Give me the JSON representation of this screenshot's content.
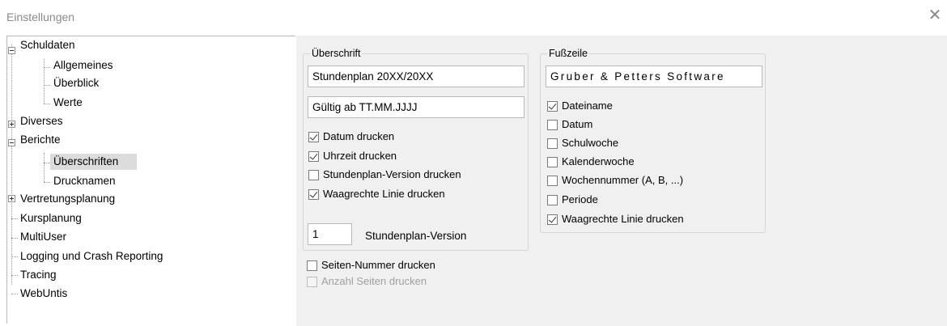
{
  "window": {
    "title": "Einstellungen",
    "close_glyph": "✕"
  },
  "tree": {
    "items": [
      {
        "label": "Schuldaten",
        "level": 0,
        "expander": "minus"
      },
      {
        "label": "Allgemeines",
        "level": 1
      },
      {
        "label": "Überblick",
        "level": 1
      },
      {
        "label": "Werte",
        "level": 1
      },
      {
        "label": "Diverses",
        "level": 0,
        "expander": "plus"
      },
      {
        "label": "Berichte",
        "level": 0,
        "expander": "minus"
      },
      {
        "label": "Überschriften",
        "level": 1,
        "selected": true
      },
      {
        "label": "Drucknamen",
        "level": 1
      },
      {
        "label": "Vertretungsplanung",
        "level": 0,
        "expander": "plus"
      },
      {
        "label": "Kursplanung",
        "level": 0
      },
      {
        "label": "MultiUser",
        "level": 0
      },
      {
        "label": "Logging und Crash Reporting",
        "level": 0
      },
      {
        "label": "Tracing",
        "level": 0
      },
      {
        "label": "WebUntis",
        "level": 0
      }
    ]
  },
  "header_group": {
    "legend": "Überschrift",
    "line1_value": "Stundenplan 20XX/20XX",
    "line2_value": "Gültig ab TT.MM.JJJJ",
    "checkboxes": [
      {
        "label": "Datum drucken",
        "checked": true
      },
      {
        "label": "Uhrzeit drucken",
        "checked": true
      },
      {
        "label": "Stundenplan-Version drucken",
        "checked": false
      },
      {
        "label": "Waagrechte Linie drucken",
        "checked": true
      }
    ],
    "version_value": "1",
    "version_label": "Stundenplan-Version"
  },
  "page_options": [
    {
      "label": "Seiten-Nummer drucken",
      "checked": false,
      "disabled": false
    },
    {
      "label": "Anzahl Seiten drucken",
      "checked": false,
      "disabled": true
    }
  ],
  "footer_group": {
    "legend": "Fußzeile",
    "text_value": "Gruber & Petters Software",
    "checkboxes": [
      {
        "label": "Dateiname",
        "checked": true
      },
      {
        "label": "Datum",
        "checked": false
      },
      {
        "label": "Schulwoche",
        "checked": false
      },
      {
        "label": "Kalenderwoche",
        "checked": false
      },
      {
        "label": "Wochennummer (A, B, ...)",
        "checked": false
      },
      {
        "label": "Periode",
        "checked": false
      },
      {
        "label": "Waagrechte Linie drucken",
        "checked": true
      }
    ]
  }
}
